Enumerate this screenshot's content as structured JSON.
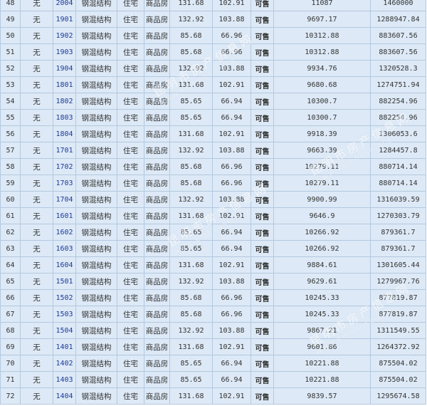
{
  "table": {
    "rows": [
      [
        "48",
        "无",
        "2004",
        "钢混结构",
        "住宅",
        "商品房",
        "131.68",
        "102.91",
        "可售",
        "11087",
        "1460000"
      ],
      [
        "49",
        "无",
        "1901",
        "钢混结构",
        "住宅",
        "商品房",
        "132.92",
        "103.88",
        "可售",
        "9697.17",
        "1288947.84"
      ],
      [
        "50",
        "无",
        "1902",
        "钢混结构",
        "住宅",
        "商品房",
        "85.68",
        "66.96",
        "可售",
        "10312.88",
        "883607.56"
      ],
      [
        "51",
        "无",
        "1903",
        "钢混结构",
        "住宅",
        "商品房",
        "85.68",
        "66.96",
        "可售",
        "10312.88",
        "883607.56"
      ],
      [
        "52",
        "无",
        "1904",
        "钢混结构",
        "住宅",
        "商品房",
        "132.92",
        "103.88",
        "可售",
        "9934.76",
        "1320528.3"
      ],
      [
        "53",
        "无",
        "1801",
        "钢混结构",
        "住宅",
        "商品房",
        "131.68",
        "102.91",
        "可售",
        "9680.68",
        "1274751.94"
      ],
      [
        "54",
        "无",
        "1802",
        "钢混结构",
        "住宅",
        "商品房",
        "85.65",
        "66.94",
        "可售",
        "10300.7",
        "882254.96"
      ],
      [
        "55",
        "无",
        "1803",
        "钢混结构",
        "住宅",
        "商品房",
        "85.65",
        "66.94",
        "可售",
        "10300.7",
        "882254.96"
      ],
      [
        "56",
        "无",
        "1804",
        "钢混结构",
        "住宅",
        "商品房",
        "131.68",
        "102.91",
        "可售",
        "9918.39",
        "1306053.6"
      ],
      [
        "57",
        "无",
        "1701",
        "钢混结构",
        "住宅",
        "商品房",
        "132.92",
        "103.88",
        "可售",
        "9663.39",
        "1284457.8"
      ],
      [
        "58",
        "无",
        "1702",
        "钢混结构",
        "住宅",
        "商品房",
        "85.68",
        "66.96",
        "可售",
        "10279.11",
        "880714.14"
      ],
      [
        "59",
        "无",
        "1703",
        "钢混结构",
        "住宅",
        "商品房",
        "85.68",
        "66.96",
        "可售",
        "10279.11",
        "880714.14"
      ],
      [
        "60",
        "无",
        "1704",
        "钢混结构",
        "住宅",
        "商品房",
        "132.92",
        "103.88",
        "可售",
        "9900.99",
        "1316039.59"
      ],
      [
        "61",
        "无",
        "1601",
        "钢混结构",
        "住宅",
        "商品房",
        "131.68",
        "102.91",
        "可售",
        "9646.9",
        "1270303.79"
      ],
      [
        "62",
        "无",
        "1602",
        "钢混结构",
        "住宅",
        "商品房",
        "85.65",
        "66.94",
        "可售",
        "10266.92",
        "879361.7"
      ],
      [
        "63",
        "无",
        "1603",
        "钢混结构",
        "住宅",
        "商品房",
        "85.65",
        "66.94",
        "可售",
        "10266.92",
        "879361.7"
      ],
      [
        "64",
        "无",
        "1604",
        "钢混结构",
        "住宅",
        "商品房",
        "131.68",
        "102.91",
        "可售",
        "9884.61",
        "1301605.44"
      ],
      [
        "65",
        "无",
        "1501",
        "钢混结构",
        "住宅",
        "商品房",
        "132.92",
        "103.88",
        "可售",
        "9629.61",
        "1279967.76"
      ],
      [
        "66",
        "无",
        "1502",
        "钢混结构",
        "住宅",
        "商品房",
        "85.68",
        "66.96",
        "可售",
        "10245.33",
        "877819.87"
      ],
      [
        "67",
        "无",
        "1503",
        "钢混结构",
        "住宅",
        "商品房",
        "85.68",
        "66.96",
        "可售",
        "10245.33",
        "877819.87"
      ],
      [
        "68",
        "无",
        "1504",
        "钢混结构",
        "住宅",
        "商品房",
        "132.92",
        "103.88",
        "可售",
        "9867.21",
        "1311549.55"
      ],
      [
        "69",
        "无",
        "1401",
        "钢混结构",
        "住宅",
        "商品房",
        "131.68",
        "102.91",
        "可售",
        "9601.86",
        "1264372.92"
      ],
      [
        "70",
        "无",
        "1402",
        "钢混结构",
        "住宅",
        "商品房",
        "85.65",
        "66.94",
        "可售",
        "10221.88",
        "875504.02"
      ],
      [
        "71",
        "无",
        "1403",
        "钢混结构",
        "住宅",
        "商品房",
        "85.65",
        "66.94",
        "可售",
        "10221.88",
        "875504.02"
      ],
      [
        "72",
        "无",
        "1404",
        "钢混结构",
        "住宅",
        "商品房",
        "131.68",
        "102.91",
        "可售",
        "9839.57",
        "1295674.58"
      ]
    ]
  },
  "watermark": {
    "cn": "昆明市房产信息网",
    "en": "www.kmhouse.org"
  },
  "colors": {
    "cell_bg": "#dde9f6",
    "border": "#b3c8e0",
    "status": "#1f7a1f",
    "room_link": "#1a3a99"
  }
}
